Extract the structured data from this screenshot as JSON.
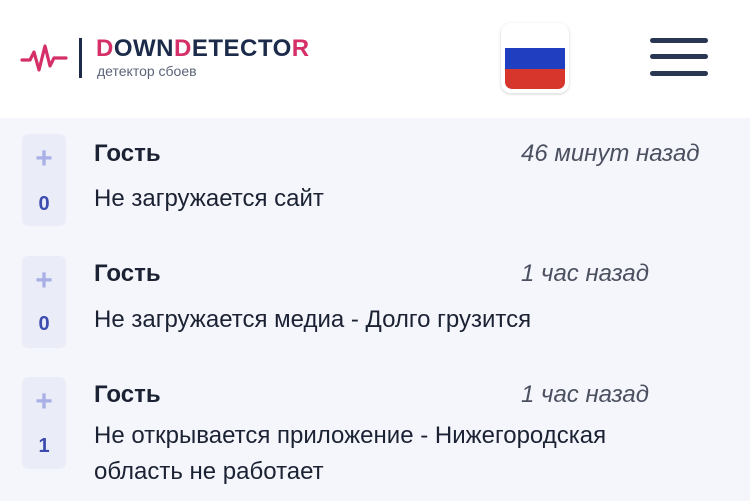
{
  "header": {
    "brand": {
      "part1": "D",
      "part2": "OWN",
      "part3": "D",
      "part4": "ETECTO",
      "part5": "R"
    },
    "tagline": "детектор сбоев",
    "icons": {
      "logo": "pulse-icon",
      "flag": "russia-flag-icon",
      "menu": "hamburger-menu-icon"
    }
  },
  "comments": [
    {
      "votes": "0",
      "author": "Гость",
      "time": "46 минут назад",
      "text": "Не загружается сайт"
    },
    {
      "votes": "0",
      "author": "Гость",
      "time": "1 час назад",
      "text": "Не загружается медиа - Долго грузится"
    },
    {
      "votes": "1",
      "author": "Гость",
      "time": "1 час назад",
      "text": "Не открывается приложение - Нижегородская область не работает"
    }
  ],
  "icons": {
    "vote": "plus-icon"
  },
  "colors": {
    "brand_pink": "#d42f68",
    "brand_navy": "#1c2b4a",
    "vote_count": "#3c4bb0",
    "vote_plus": "#a8b0e6",
    "vote_bg": "#eaecf8"
  }
}
